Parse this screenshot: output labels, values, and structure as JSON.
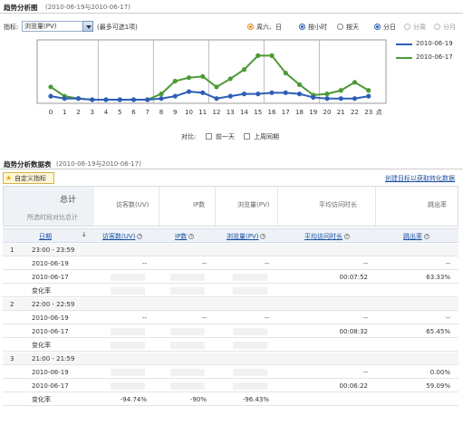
{
  "trend": {
    "title": "趋势分析图",
    "subtitle": "(2010-06-19与2010-06-17)",
    "metric_label": "指标:",
    "metric_value": "浏览量(PV)",
    "metric_hint": "(最多可选1项)",
    "day_type_label": "周六、日",
    "group_hour_label": "按小时",
    "group_day_label": "按天",
    "split_day_label": "分日",
    "split_week_label": "分周",
    "split_month_label": "分月",
    "legend": [
      "2010-06-19",
      "2010-06-17"
    ],
    "compare_label": "对比:",
    "compare_prev_day": "前一天",
    "compare_prev_week": "上周同期",
    "x_suffix": "点"
  },
  "chart_data": {
    "type": "line",
    "x": [
      0,
      1,
      2,
      3,
      4,
      5,
      6,
      7,
      8,
      9,
      10,
      11,
      12,
      13,
      14,
      15,
      16,
      17,
      18,
      19,
      20,
      21,
      22,
      23
    ],
    "series": [
      {
        "name": "2010-06-19",
        "color": "#2e5fb5",
        "values": [
          3,
          1,
          1,
          0,
          0,
          0,
          0,
          0,
          1,
          3,
          7,
          6,
          1,
          3,
          5,
          5,
          6,
          6,
          5,
          2,
          1,
          1,
          1,
          3
        ]
      },
      {
        "name": "2010-06-17",
        "color": "#4c9a36",
        "values": [
          11,
          3,
          1,
          0,
          0,
          0,
          0,
          0,
          5,
          16,
          19,
          20,
          11,
          18,
          26,
          38,
          38,
          23,
          13,
          4,
          5,
          8,
          15,
          8
        ]
      }
    ],
    "ylim": [
      0,
      50
    ],
    "grid": true
  },
  "table": {
    "title": "趋势分析数据表",
    "subtitle": "(2010-06-19与2010-06-17)",
    "custom_metric_label": "自定义指标",
    "create_goal_link": "创建目标以获取转化数据",
    "total_label": "总计",
    "total_sub": "所选时段对比总计",
    "summary_headers": [
      "访客数(UV)",
      "IP数",
      "浏览量(PV)",
      "平均访问时长",
      "跳出率"
    ],
    "columns": [
      "日期",
      "访客数(UV)",
      "IP数",
      "浏览量(PV)",
      "平均访问时长",
      "跳出率"
    ],
    "sort_icon": "↓",
    "groups": [
      {
        "index": "1",
        "range": "23:00 - 23:59",
        "rows": [
          {
            "date": "2010-06-19",
            "uv": "--",
            "ip": "--",
            "pv": "--",
            "dur": "--",
            "bounce": "--"
          },
          {
            "date": "2010-06-17",
            "uv": "",
            "ip": "",
            "pv": "",
            "dur": "00:07:52",
            "bounce": "63.33%"
          },
          {
            "date": "变化率",
            "uv": "",
            "ip": "",
            "pv": "",
            "dur": "",
            "bounce": ""
          }
        ]
      },
      {
        "index": "2",
        "range": "22:00 - 22:59",
        "rows": [
          {
            "date": "2010-06-19",
            "uv": "--",
            "ip": "--",
            "pv": "--",
            "dur": "--",
            "bounce": "--"
          },
          {
            "date": "2010-06-17",
            "uv": "",
            "ip": "",
            "pv": "",
            "dur": "00:08:32",
            "bounce": "65.45%"
          },
          {
            "date": "变化率",
            "uv": "",
            "ip": "",
            "pv": "",
            "dur": "",
            "bounce": ""
          }
        ]
      },
      {
        "index": "3",
        "range": "21:00 - 21:59",
        "rows": [
          {
            "date": "2010-06-19",
            "uv": "",
            "ip": "",
            "pv": "",
            "dur": "--",
            "bounce": "0.00%"
          },
          {
            "date": "2010-06-17",
            "uv": "",
            "ip": "",
            "pv": "",
            "dur": "00:06:22",
            "bounce": "59.09%"
          },
          {
            "date": "变化率",
            "uv": "-94.74%",
            "ip": "-90%",
            "pv": "-96.43%",
            "dur": "",
            "bounce": ""
          }
        ]
      }
    ]
  }
}
